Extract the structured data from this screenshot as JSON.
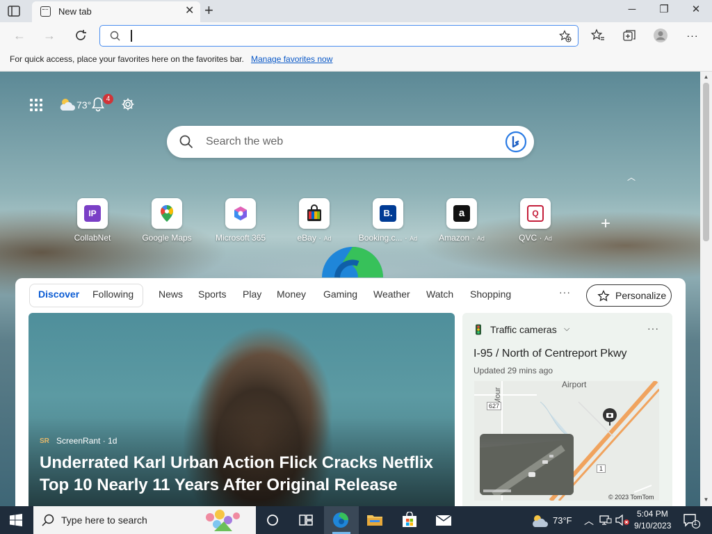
{
  "browser": {
    "tab_title": "New tab",
    "favorites_bar": {
      "message": "For quick access, place your favorites here on the favorites bar.",
      "link": "Manage favorites now"
    }
  },
  "ntp": {
    "weather_temp": "73°",
    "notification_count": "4",
    "search_placeholder": "Search the web",
    "tiles": [
      {
        "label": "CollabNet",
        "ad": "",
        "color": "#7a3fc6",
        "glyph": "IP"
      },
      {
        "label": "Google Maps",
        "ad": "",
        "color": "#34a853",
        "glyph": "●"
      },
      {
        "label": "Microsoft 365",
        "ad": "",
        "color": "#7b5ee8",
        "glyph": "◆"
      },
      {
        "label": "eBay",
        "ad": "Ad",
        "color": "#e53238",
        "glyph": "▦"
      },
      {
        "label": "Booking.c...",
        "ad": "Ad",
        "color": "#003b95",
        "glyph": "B."
      },
      {
        "label": "Amazon",
        "ad": "Ad",
        "color": "#111111",
        "glyph": "a"
      },
      {
        "label": "QVC",
        "ad": "Ad",
        "color": "#ffffff",
        "glyph": "Q"
      }
    ],
    "feed": {
      "tabs": [
        "Discover",
        "Following",
        "News",
        "Sports",
        "Play",
        "Money",
        "Gaming",
        "Weather",
        "Watch",
        "Shopping"
      ],
      "more": "···",
      "personalize": "Personalize",
      "hero": {
        "source": "ScreenRant · 1d",
        "title": "Underrated Karl Urban Action Flick Cracks Netflix Top 10 Nearly 11 Years After Original Release"
      },
      "traffic": {
        "heading": "Traffic cameras",
        "road": "I-95 / North of Centreport Pkwy",
        "updated": "Updated 29 mins ago",
        "map_labels": {
          "airport": "Airport",
          "street": "Mour",
          "route": "627",
          "route2": "1",
          "copyright": "© 2023 TomTom"
        }
      }
    }
  },
  "taskbar": {
    "search_placeholder": "Type here to search",
    "weather": "73°F",
    "time": "5:04 PM",
    "date": "9/10/2023",
    "notification_count": "1"
  }
}
